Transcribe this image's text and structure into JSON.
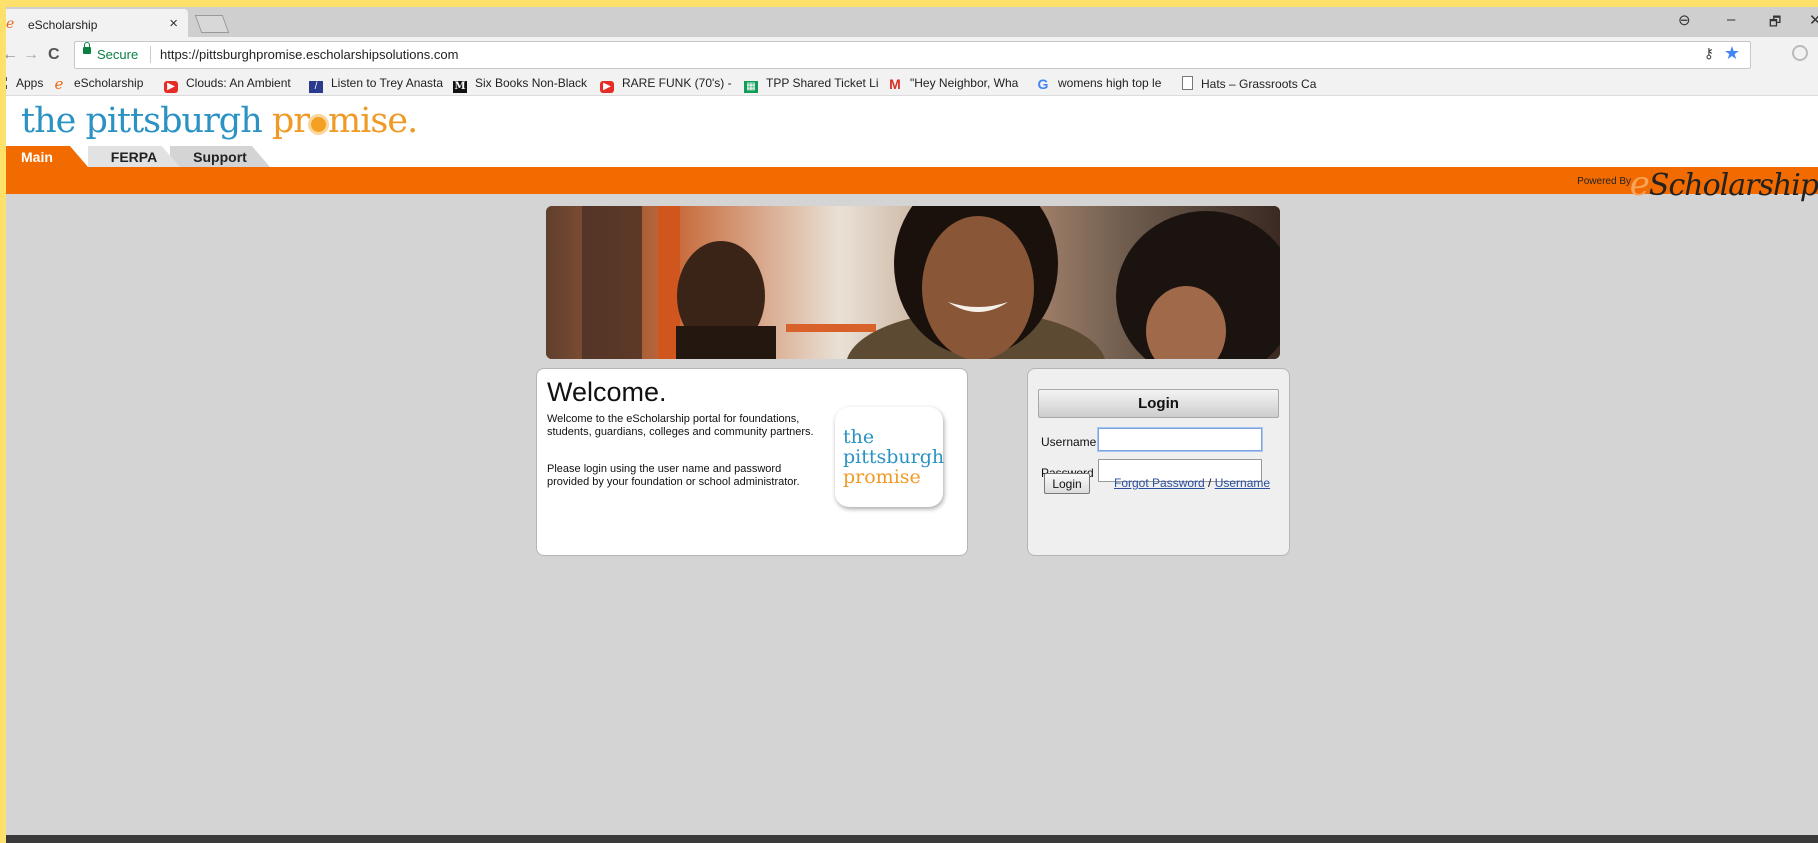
{
  "browser": {
    "tab_title": "eScholarship",
    "tab_close": "×",
    "back": "←",
    "forward": "→",
    "reload": "C",
    "secure_label": "Secure",
    "url": "https://pittsburghpromise.escholarshipsolutions.com",
    "window_controls": {
      "account": "⊖",
      "minimize": "–",
      "restore": "🗗",
      "close": "✕"
    },
    "key_glyph": "⚷",
    "star_glyph": "★"
  },
  "bookmarks": [
    {
      "label": "Apps",
      "icon": "apps-grid-icon"
    },
    {
      "label": "eScholarship",
      "icon": "escholarship-icon"
    },
    {
      "label": "Clouds: An Ambient",
      "icon": "youtube-icon"
    },
    {
      "label": "Listen to Trey Anasta",
      "icon": "podcast-icon"
    },
    {
      "label": "Six Books Non-Black",
      "icon": "medium-icon"
    },
    {
      "label": "RARE FUNK (70's) - (",
      "icon": "youtube-icon"
    },
    {
      "label": "TPP Shared Ticket Li",
      "icon": "sheets-icon"
    },
    {
      "label": "\"Hey Neighbor, Wha",
      "icon": "gmail-icon"
    },
    {
      "label": "womens high top le",
      "icon": "google-icon"
    },
    {
      "label": "Hats – Grassroots Ca",
      "icon": "document-icon"
    }
  ],
  "site": {
    "logo": {
      "part1": "the pittsburgh ",
      "part2a": "pr",
      "part2b": "mise."
    },
    "nav_tabs": [
      "Main",
      "FERPA",
      "Support"
    ],
    "powered_by": "Powered By",
    "brand": {
      "e": "e",
      "rest": "Scholarship"
    }
  },
  "welcome": {
    "heading": "Welcome.",
    "paragraph1": "Welcome to the eScholarship portal for foundations, students, guardians, colleges and community partners.",
    "paragraph2": "Please login using the user name and password provided by your foundation or school administrator.",
    "logo_lines": [
      "the",
      "pittsburgh",
      "promise"
    ]
  },
  "login": {
    "heading": "Login",
    "username_label": "Username",
    "password_label": "Password",
    "username_value": "",
    "password_value": "",
    "button_label": "Login",
    "forgot_password": "Forgot Password",
    "separator": " / ",
    "username_link": "Username"
  },
  "colors": {
    "accent_orange": "#f26b00",
    "promise_blue": "#2b92c4",
    "promise_orange": "#f09a26",
    "page_background": "#d4d4d4"
  }
}
